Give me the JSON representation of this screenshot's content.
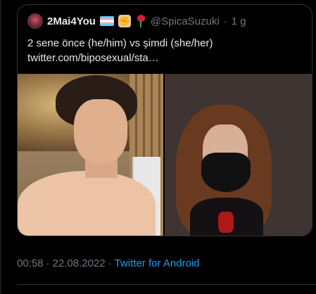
{
  "quote": {
    "display_name": "2Mai4You",
    "handle": "@SpicaSuzuki",
    "separator": "·",
    "time": "1 g",
    "emoji_icons": [
      "transgender-flag-icon",
      "raised-fist-icon",
      "rose-icon"
    ],
    "text_line1": "2 sene önce (he/him) vs şimdi (she/her)",
    "text_line2": "twitter.com/biposexual/sta…"
  },
  "tweet_footer": {
    "time": "00:58",
    "dot1": "·",
    "date": "22.08.2022",
    "dot2": "·",
    "source": "Twitter for Android"
  },
  "colors": {
    "background": "#000000",
    "text": "#e7e9ea",
    "muted": "#71767b",
    "link": "#1d9bf0",
    "border": "#2f3336"
  }
}
